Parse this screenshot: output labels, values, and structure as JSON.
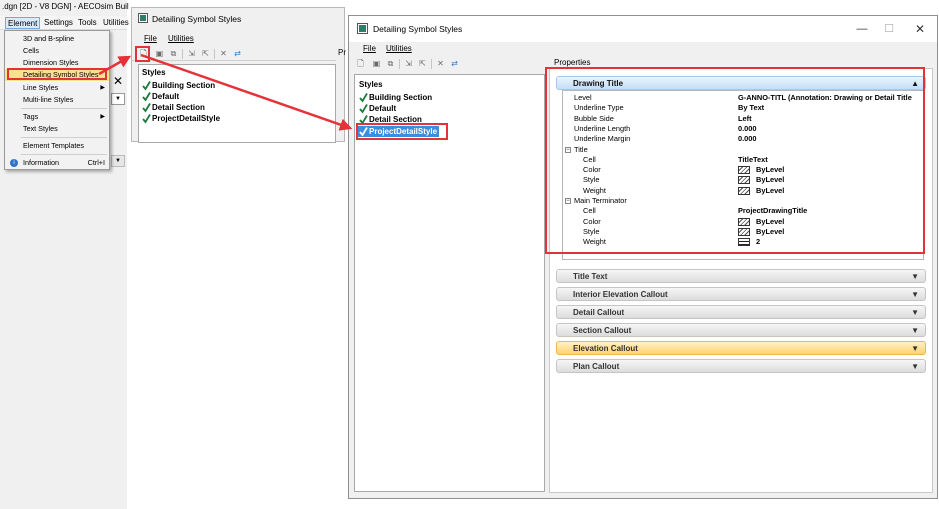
{
  "app": {
    "title": ".dgn [2D - V8 DGN] - AECOsim Buil",
    "menubar": [
      "Element",
      "Settings",
      "Tools",
      "Utilities"
    ]
  },
  "element_menu": {
    "items": [
      {
        "label": "3D and B-spline",
        "arrow": false
      },
      {
        "label": "Cells",
        "arrow": false
      },
      {
        "label": "Dimension Styles",
        "arrow": false
      },
      {
        "label": "Detailing Symbol Styles",
        "arrow": false
      },
      {
        "label": "Line Styles",
        "arrow": true
      },
      {
        "label": "Multi-line Styles",
        "arrow": false
      },
      {
        "label": "Tags",
        "arrow": true
      },
      {
        "label": "Text Styles",
        "arrow": false
      },
      {
        "label": "Element Templates",
        "arrow": false
      },
      {
        "label": "Information",
        "accel": "Ctrl+I"
      }
    ]
  },
  "small_dialog": {
    "title": "Detailing Symbol Styles",
    "menu": [
      "File",
      "Utilities"
    ],
    "properties_label": "Pr",
    "styles_header": "Styles",
    "styles": [
      "Building Section",
      "Default",
      "Detail Section",
      "ProjectDetailStyle"
    ]
  },
  "big_dialog": {
    "title": "Detailing Symbol Styles",
    "window_buttons": {
      "minimize": "—",
      "maximize": "☐",
      "close": "✕"
    },
    "menu": [
      "File",
      "Utilities"
    ],
    "properties_label": "Properties",
    "styles_header": "Styles",
    "styles": [
      "Building Section",
      "Default",
      "Detail Section",
      "ProjectDetailStyle"
    ],
    "selected_style": "ProjectDetailStyle",
    "drawing_title": {
      "header": "Drawing Title",
      "rows": [
        {
          "name": "Level",
          "value": "G-ANNO-TITL (Annotation: Drawing or Detail Title"
        },
        {
          "name": "Underline Type",
          "value": "By Text"
        },
        {
          "name": "Bubble Side",
          "value": "Left"
        },
        {
          "name": "Underline Length",
          "value": "0.000"
        },
        {
          "name": "Underline Margin",
          "value": "0.000"
        },
        {
          "group": "Title"
        },
        {
          "name": "Cell",
          "value": "TitleText"
        },
        {
          "name": "Color",
          "value": "ByLevel",
          "swatch": "hatch"
        },
        {
          "name": "Style",
          "value": "ByLevel",
          "swatch": "hatch"
        },
        {
          "name": "Weight",
          "value": "ByLevel",
          "swatch": "hatch"
        },
        {
          "group": "Main Terminator"
        },
        {
          "name": "Cell",
          "value": "ProjectDrawingTitle"
        },
        {
          "name": "Color",
          "value": "ByLevel",
          "swatch": "hatch"
        },
        {
          "name": "Style",
          "value": "ByLevel",
          "swatch": "hatch"
        },
        {
          "name": "Weight",
          "value": "2",
          "swatch": "line"
        }
      ]
    },
    "sections": [
      {
        "label": "Title Text"
      },
      {
        "label": "Interior Elevation Callout"
      },
      {
        "label": "Detail Callout"
      },
      {
        "label": "Section Callout"
      },
      {
        "label": "Elevation Callout",
        "highlighted": true
      },
      {
        "label": "Plan Callout"
      }
    ]
  },
  "colors": {
    "highlight_red": "#e53238",
    "selection_blue": "#3a8ee0",
    "elevation_gold": "#ffd26e",
    "drawing_header_blue": "#c4def6"
  }
}
